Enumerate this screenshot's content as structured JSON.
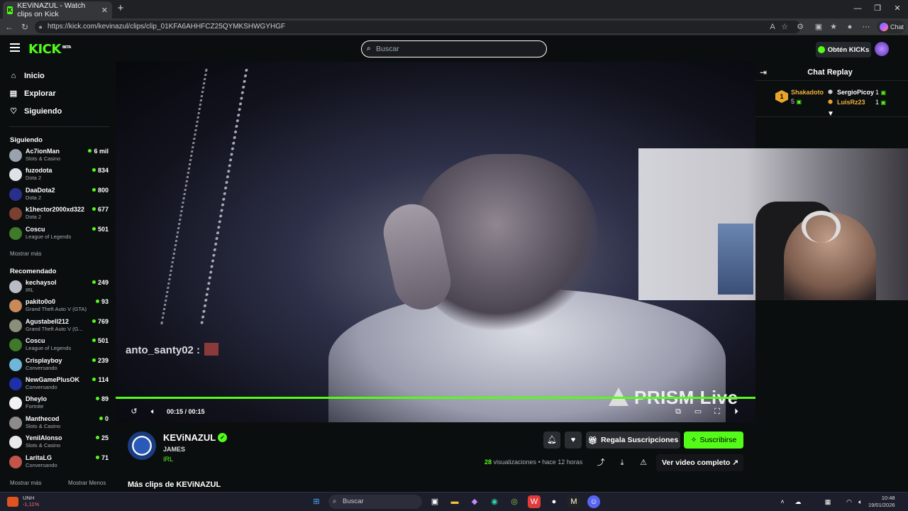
{
  "browser": {
    "tab_title": "KEViNAZUL - Watch clips on Kick",
    "url": "https://kick.com/kevinazul/clips/clip_01KFA6AHHFCZ25QYMKSHWGYHGF",
    "copilot_label": "Chat"
  },
  "header": {
    "logo": "KICK",
    "logo_badge": "BETA",
    "search_placeholder": "Buscar",
    "kicks_button": "Obtén KICKs"
  },
  "sidebar": {
    "nav": [
      "Inicio",
      "Explorar",
      "Siguiendo"
    ],
    "following_title": "Siguiendo",
    "following": [
      {
        "name": "Ac7ionMan",
        "category": "Slots & Casino",
        "viewers": "6 mil",
        "color": "#9aa3ad"
      },
      {
        "name": "fuzodota",
        "category": "Dota 2",
        "viewers": "834",
        "color": "#dfe3e8"
      },
      {
        "name": "DaaDota2",
        "category": "Dota 2",
        "viewers": "800",
        "color": "#2b2f8c"
      },
      {
        "name": "k1hector2000xd322",
        "category": "Dota 2",
        "viewers": "677",
        "color": "#7a4030"
      },
      {
        "name": "Coscu",
        "category": "League of Legends",
        "viewers": "501",
        "color": "#3e7a2a"
      }
    ],
    "show_more": "Mostrar más",
    "recommended_title": "Recomendado",
    "recommended": [
      {
        "name": "kechaysol",
        "category": "IRL",
        "viewers": "249",
        "color": "#b9bcc2"
      },
      {
        "name": "pakito0o0",
        "category": "Grand Theft Auto V (GTA)",
        "viewers": "93",
        "color": "#c98a5a"
      },
      {
        "name": "Agustabell212",
        "category": "Grand Theft Auto V (G...",
        "viewers": "769",
        "color": "#8a8f7a"
      },
      {
        "name": "Coscu",
        "category": "League of Legends",
        "viewers": "501",
        "color": "#3e7a2a"
      },
      {
        "name": "Crisplayboy",
        "category": "Conversando",
        "viewers": "239",
        "color": "#6fb6d8"
      },
      {
        "name": "NewGamePlusOK",
        "category": "Conversando",
        "viewers": "114",
        "color": "#1f2fa8"
      },
      {
        "name": "Dheylo",
        "category": "Fortnite",
        "viewers": "89",
        "color": "#f2f2f2"
      },
      {
        "name": "Manthecod",
        "category": "Slots & Casino",
        "viewers": "0",
        "color": "#8e8a8a"
      },
      {
        "name": "YeniIAlonso",
        "category": "Slots & Casino",
        "viewers": "25",
        "color": "#e9e9e9"
      },
      {
        "name": "LaritaLG",
        "category": "Conversando",
        "viewers": "71",
        "color": "#c2554a"
      }
    ],
    "show_more_bottom": "Mostrar más",
    "show_less": "Mostrar Menos"
  },
  "video": {
    "overlay_chat": "anto_santy02 :",
    "watermark": "PRISM Live",
    "time": "00:15 / 00:15",
    "progress": 1.0
  },
  "chat": {
    "title": "Chat Replay",
    "leaders": [
      {
        "rank": "1",
        "name": "Shakadoto",
        "count": "5"
      },
      {
        "name": "SergioPicoy",
        "count": "1"
      },
      {
        "name": "LuisRz23",
        "count": "1"
      }
    ]
  },
  "clip": {
    "channel": "KEViNAZUL",
    "title": "JAMES",
    "category": "IRL",
    "gift_button": "Regala Suscripciones",
    "subscribe_button": "Suscribirse",
    "views_count": "28",
    "views_label": "visualizaciones",
    "age": "• hace 12 horas",
    "full_video": "Ver video completo",
    "more_clips": "Más clips de KEViNAZUL"
  },
  "taskbar": {
    "stock_name": "UNH",
    "stock_change": "-1,11%",
    "search": "Buscar",
    "time": "10:48",
    "date": "19/01/2026"
  }
}
